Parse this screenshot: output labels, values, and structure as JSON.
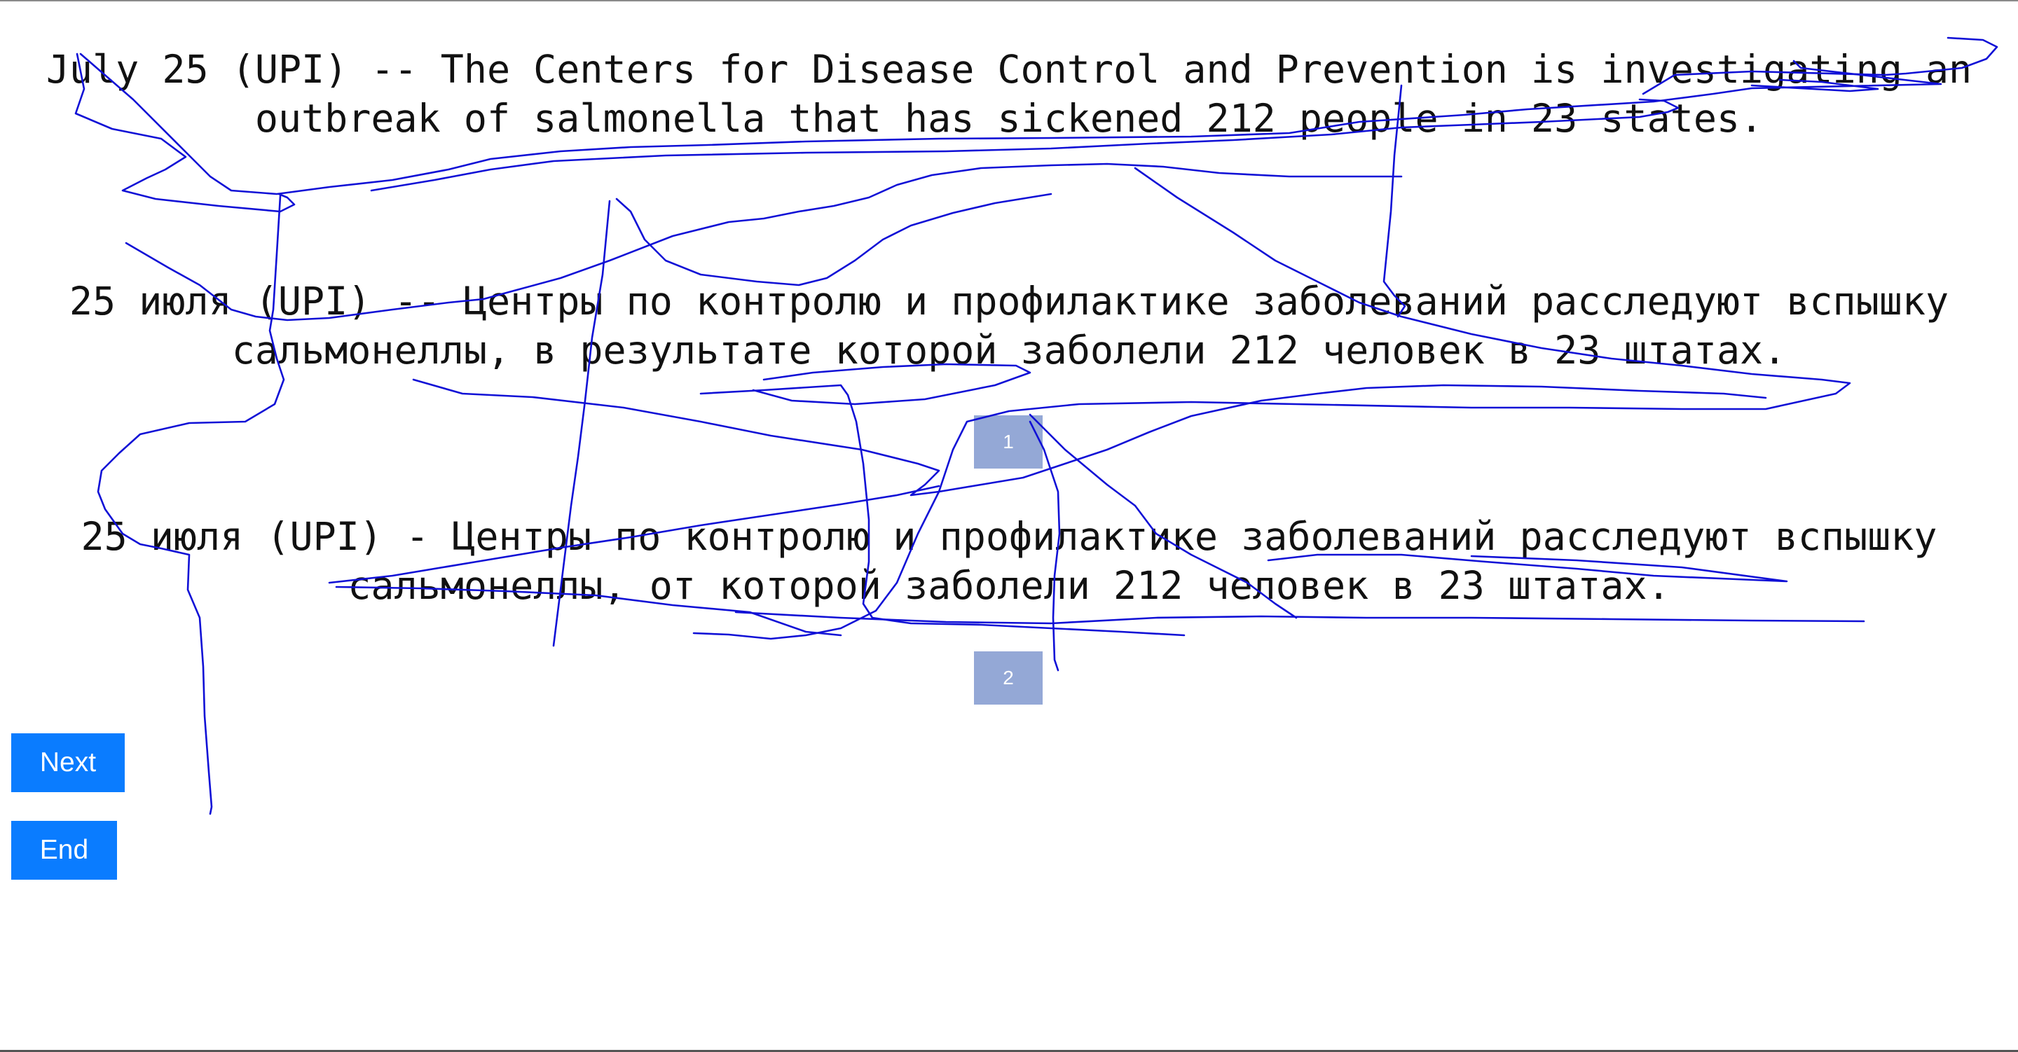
{
  "source_text": "July 25 (UPI) -- The Centers for Disease Control and Prevention is investigating an outbreak of salmonella that has sickened 212 people in 23 states.",
  "translations": [
    {
      "text": "25 июля (UPI) -- Центры по контролю и профилактике заболеваний расследуют вспышку сальмонеллы, в результате которой заболели 212 человек в 23 штатах.",
      "badge": "1"
    },
    {
      "text": "25 июля (UPI) - Центры по контролю и профилактике заболеваний расследуют вспышку сальмонеллы, от которой заболели 212 человек в 23 штатах.",
      "badge": "2"
    }
  ],
  "buttons": {
    "next_label": "Next",
    "end_label": "End"
  },
  "colors": {
    "button": "#0a7cff",
    "badge": "#94a8d6",
    "scribble": "#1010d6"
  }
}
